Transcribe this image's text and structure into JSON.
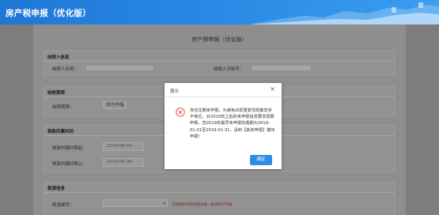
{
  "header": {
    "title": "房产税申报（优化版）"
  },
  "page": {
    "title": "房产税申报（优化版）"
  },
  "taxpayer": {
    "title": "纳税人信息",
    "name_label": "纳税人名称：",
    "id_label": "纳税人识别号："
  },
  "period": {
    "title": "纳税期限",
    "label": "纳税期限：",
    "value": "按月申报"
  },
  "tax_period": {
    "title": "税款所属时间",
    "start_label": "税款所属时期起：",
    "start_value": "2019-06-01",
    "end_label": "税款所属时期止：",
    "end_value": "2019-06-30"
  },
  "source": {
    "title": "税源信息",
    "label": "税源编号：",
    "hint": "可选择所有税源或选择一税源进行申报"
  },
  "dialog": {
    "title": "提示",
    "message": "存在往期未申报，为避免出现重复性政策享受不到位，对2019年之后的未申报信息要求逐期申报，您2019年最早未申报的属期为2019-01-01至2019-01-31，请到【其他申报】模块申报!",
    "confirm_label": "确定"
  },
  "colors": {
    "header_blue": "#2b8be6",
    "button_blue": "#2f8be6",
    "error_red": "#e23b3b"
  },
  "icons": [
    "close-icon",
    "error-circle-icon",
    "chevron-down-icon",
    "great-wall-icon"
  ]
}
